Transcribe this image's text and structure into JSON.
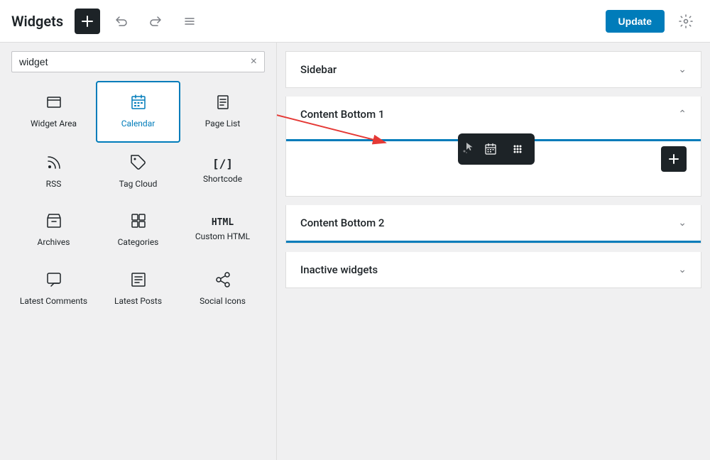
{
  "header": {
    "title": "Widgets",
    "add_btn_label": "+",
    "update_btn_label": "Update"
  },
  "search": {
    "placeholder": "widget",
    "value": "widget",
    "clear_label": "×"
  },
  "widgets": [
    {
      "id": "widget-area",
      "icon": "📋",
      "label": "Widget Area",
      "selected": false
    },
    {
      "id": "calendar",
      "icon": "📅",
      "label": "Calendar",
      "selected": true
    },
    {
      "id": "page-list",
      "icon": "📄",
      "label": "Page List",
      "selected": false
    },
    {
      "id": "rss",
      "icon": "📡",
      "label": "RSS",
      "selected": false
    },
    {
      "id": "tag-cloud",
      "icon": "🏷",
      "label": "Tag Cloud",
      "selected": false
    },
    {
      "id": "shortcode",
      "icon": "[/]",
      "label": "Shortcode",
      "selected": false
    },
    {
      "id": "archives",
      "icon": "📁",
      "label": "Archives",
      "selected": false
    },
    {
      "id": "categories",
      "icon": "⊞",
      "label": "Categories",
      "selected": false
    },
    {
      "id": "custom-html",
      "icon": "HTML",
      "label": "Custom HTML",
      "selected": false
    },
    {
      "id": "latest-comments",
      "icon": "💬",
      "label": "Latest Comments",
      "selected": false
    },
    {
      "id": "latest-posts",
      "icon": "📋",
      "label": "Latest Posts",
      "selected": false
    },
    {
      "id": "social-icons",
      "icon": "⋖",
      "label": "Social Icons",
      "selected": false
    }
  ],
  "sidebar": {
    "label": "Sidebar",
    "collapsed": true
  },
  "content_bottom_1": {
    "label": "Content Bottom 1",
    "collapsed": false
  },
  "content_bottom_2": {
    "label": "Content Bottom 2",
    "collapsed": true
  },
  "inactive_widgets": {
    "label": "Inactive widgets",
    "collapsed": true
  },
  "toolbar": {
    "calendar_icon": "📅",
    "grid_icon": "⠿"
  }
}
